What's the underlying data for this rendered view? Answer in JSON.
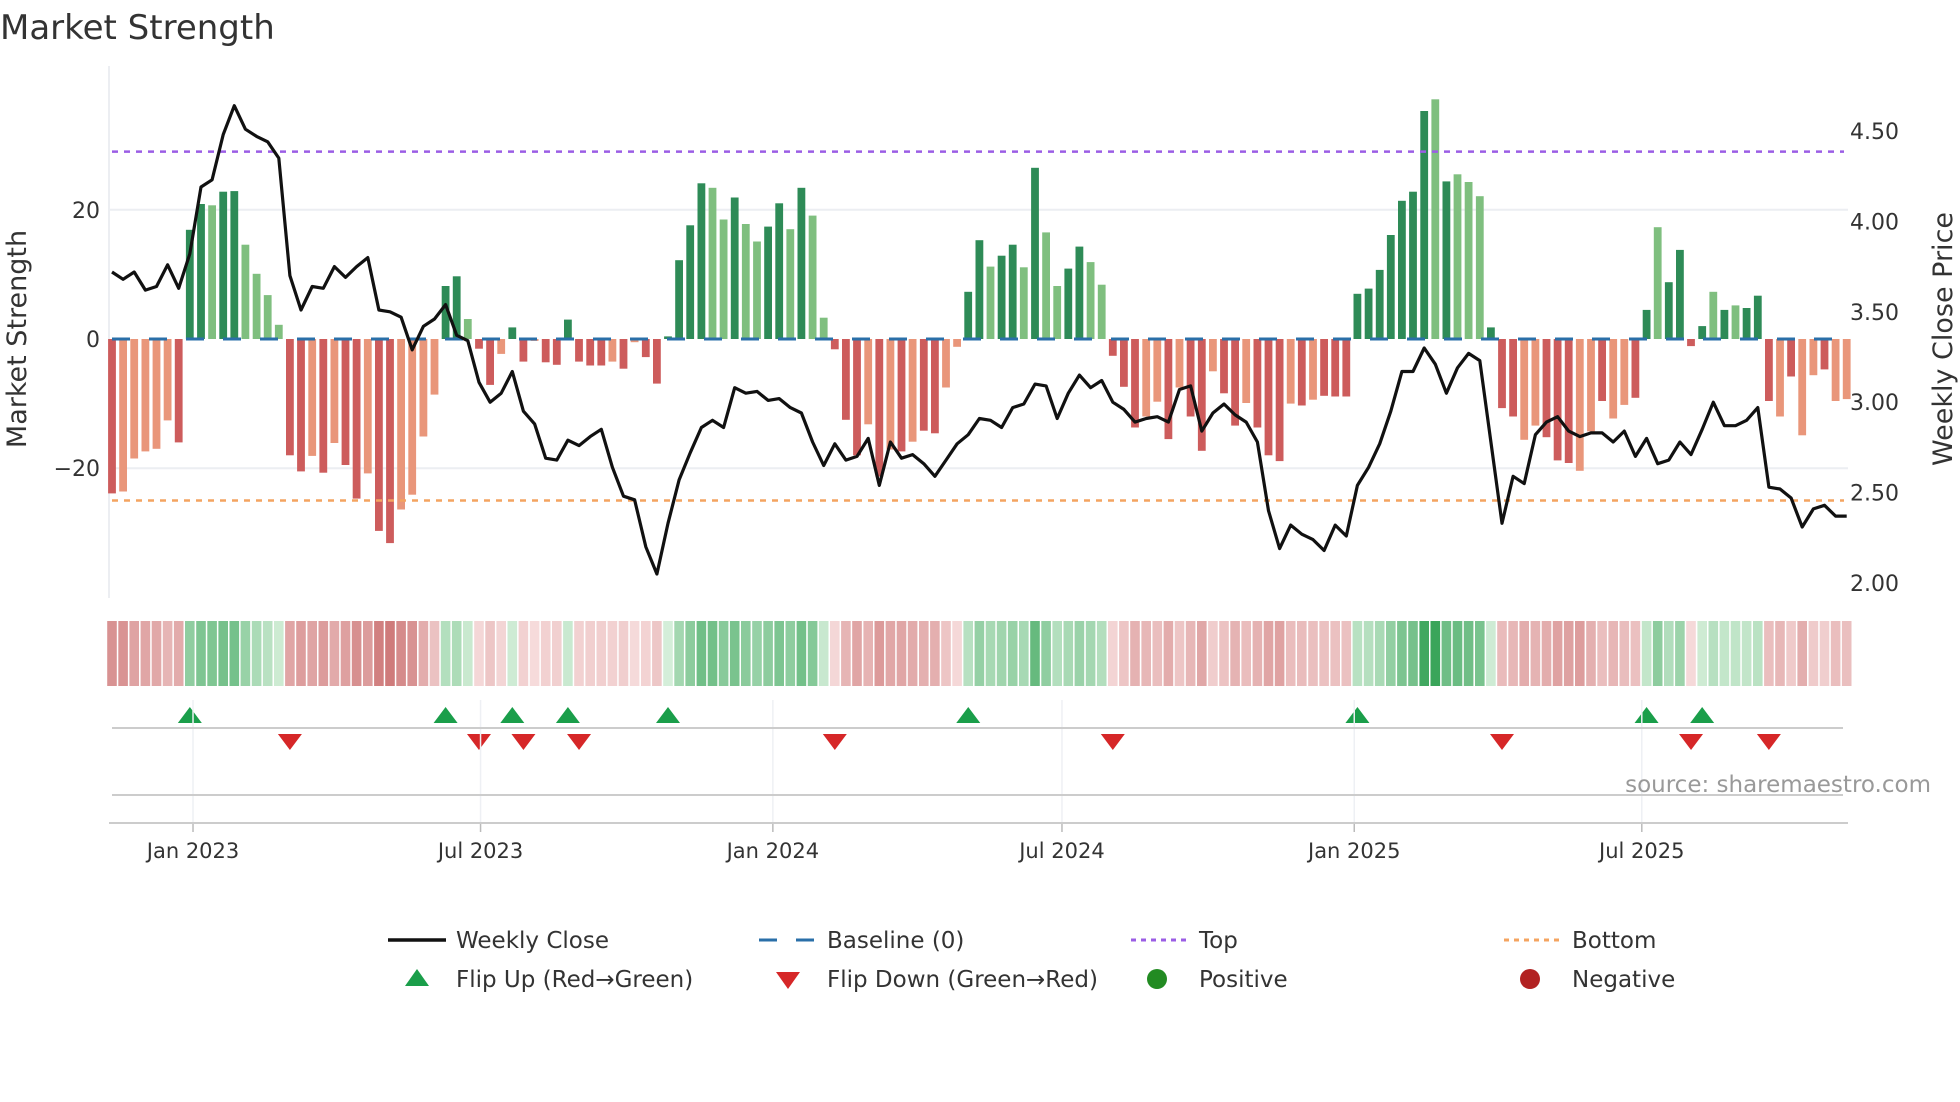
{
  "chart_data": {
    "type": "bar",
    "title": "Market Strength",
    "ylabel": "Market Strength",
    "y2label": "Weekly Close Price",
    "ylim": [
      -40,
      40
    ],
    "y2lim": [
      1.92,
      4.78
    ],
    "start_date": "2022-11-11",
    "frequency": "weekly",
    "yticks": [
      {
        "value": 20,
        "label": "20"
      },
      {
        "value": 0,
        "label": "0"
      },
      {
        "value": -20,
        "label": "−20"
      }
    ],
    "y2ticks": [
      {
        "value": 4.5,
        "label": "4.50"
      },
      {
        "value": 4.0,
        "label": "4.00"
      },
      {
        "value": 3.5,
        "label": "3.50"
      },
      {
        "value": 3.0,
        "label": "3.00"
      },
      {
        "value": 2.5,
        "label": "2.50"
      },
      {
        "value": 2.0,
        "label": "2.00"
      }
    ],
    "xticks": [
      {
        "date": "2023-01-01",
        "label": "Jan 2023"
      },
      {
        "date": "2023-07-01",
        "label": "Jul 2023"
      },
      {
        "date": "2024-01-01",
        "label": "Jan 2024"
      },
      {
        "date": "2024-07-01",
        "label": "Jul 2024"
      },
      {
        "date": "2025-01-01",
        "label": "Jan 2025"
      },
      {
        "date": "2025-07-01",
        "label": "Jul 2025"
      }
    ],
    "top_level": 29,
    "bottom_level": -25,
    "baseline": 0,
    "strength": [
      -23.9,
      -23.6,
      -18.5,
      -17.4,
      -17.0,
      -12.6,
      -16.0,
      16.9,
      20.9,
      20.7,
      22.8,
      22.9,
      14.6,
      10.1,
      6.8,
      2.2,
      -18.0,
      -20.5,
      -18.1,
      -20.7,
      -16.1,
      -19.5,
      -24.7,
      -20.8,
      -29.7,
      -31.6,
      -26.4,
      -24.1,
      -15.1,
      -8.6,
      8.2,
      9.7,
      3.1,
      -1.5,
      -7.1,
      -2.3,
      1.8,
      -3.5,
      -0.3,
      -3.6,
      -4.0,
      3.0,
      -3.5,
      -4.1,
      -4.1,
      -3.5,
      -4.6,
      -0.5,
      -2.8,
      -6.9,
      0.4,
      12.2,
      17.6,
      24.1,
      23.4,
      18.5,
      21.9,
      17.8,
      15.1,
      17.4,
      21.0,
      17.0,
      23.4,
      19.1,
      3.3,
      -1.6,
      -12.5,
      -18.0,
      -13.2,
      -21.3,
      -17.1,
      -17.4,
      -15.9,
      -14.2,
      -14.6,
      -7.5,
      -1.2,
      7.3,
      15.3,
      11.2,
      12.9,
      14.6,
      11.1,
      26.5,
      16.5,
      8.2,
      10.9,
      14.3,
      11.9,
      8.4,
      -2.6,
      -7.4,
      -13.7,
      -12.0,
      -9.7,
      -15.5,
      -7.5,
      -12.0,
      -17.3,
      -5.0,
      -8.4,
      -13.4,
      -9.9,
      -13.7,
      -18.0,
      -18.9,
      -10.0,
      -10.3,
      -9.4,
      -8.8,
      -8.9,
      -8.9,
      7.0,
      7.8,
      10.7,
      16.1,
      21.4,
      22.8,
      35.3,
      37.1,
      24.4,
      25.5,
      24.3,
      22.1,
      1.8,
      -10.7,
      -12.0,
      -15.6,
      -13.4,
      -15.2,
      -18.8,
      -19.2,
      -20.4,
      -14.3,
      -9.6,
      -12.3,
      -10.2,
      -9.1,
      4.5,
      17.3,
      8.8,
      13.8,
      -1.1,
      2.0,
      7.3,
      4.5,
      5.2,
      4.8,
      6.7,
      -9.6,
      -12.0,
      -5.8,
      -14.9,
      -5.6,
      -4.7,
      -9.6,
      -9.3
    ],
    "shade": "DLLLLLDDDLDDLLLLDDLDLDDLDDLLLLDDLDDLDDLDDDDDDLDLDDDDDDLLDLLDDLDLLDDDLDLDLDDLLDDLDDLDLLDDLLDDDLLDLDDLDDLDDDLDLDDDDDDDDDDLDLLLDDDLLDDDLLDLLDDLDDDDLDLDDDLDLLDL",
    "weekly_close": [
      3.72,
      3.68,
      3.72,
      3.62,
      3.64,
      3.76,
      3.63,
      3.82,
      4.19,
      4.23,
      4.48,
      4.64,
      4.51,
      4.47,
      4.44,
      4.35,
      3.7,
      3.51,
      3.64,
      3.63,
      3.75,
      3.69,
      3.75,
      3.8,
      3.51,
      3.5,
      3.47,
      3.29,
      3.42,
      3.46,
      3.54,
      3.37,
      3.34,
      3.11,
      3.0,
      3.05,
      3.17,
      2.95,
      2.88,
      2.69,
      2.68,
      2.79,
      2.76,
      2.81,
      2.85,
      2.64,
      2.48,
      2.46,
      2.2,
      2.05,
      2.33,
      2.57,
      2.72,
      2.86,
      2.9,
      2.86,
      3.08,
      3.05,
      3.06,
      3.01,
      3.02,
      2.97,
      2.94,
      2.78,
      2.65,
      2.77,
      2.68,
      2.7,
      2.8,
      2.54,
      2.78,
      2.69,
      2.71,
      2.66,
      2.59,
      2.68,
      2.77,
      2.82,
      2.91,
      2.9,
      2.86,
      2.97,
      2.99,
      3.1,
      3.09,
      2.91,
      3.05,
      3.15,
      3.08,
      3.12,
      3.0,
      2.96,
      2.89,
      2.91,
      2.92,
      2.89,
      3.07,
      3.09,
      2.84,
      2.94,
      2.99,
      2.93,
      2.89,
      2.78,
      2.4,
      2.19,
      2.32,
      2.27,
      2.24,
      2.18,
      2.32,
      2.26,
      2.54,
      2.64,
      2.77,
      2.95,
      3.17,
      3.17,
      3.3,
      3.21,
      3.05,
      3.19,
      3.27,
      3.23,
      2.78,
      2.33,
      2.59,
      2.55,
      2.82,
      2.89,
      2.92,
      2.84,
      2.81,
      2.83,
      2.83,
      2.78,
      2.84,
      2.7,
      2.8,
      2.66,
      2.68,
      2.78,
      2.71,
      2.85,
      3.0,
      2.87,
      2.87,
      2.9,
      2.97,
      2.53,
      2.52,
      2.47,
      2.31,
      2.41,
      2.43,
      2.37,
      2.37
    ],
    "flip_up_weeks": [
      8,
      31,
      37,
      42,
      51,
      78,
      113,
      139,
      144
    ],
    "flip_down_weeks": [
      17,
      34,
      38,
      43,
      66,
      91,
      126,
      143,
      150
    ],
    "legend": [
      {
        "label": "Weekly Close",
        "kind": "line"
      },
      {
        "label": "Baseline (0)",
        "kind": "dash"
      },
      {
        "label": "Top",
        "kind": "dot-top"
      },
      {
        "label": "Bottom",
        "kind": "dot-bottom"
      },
      {
        "label": "Flip Up (Red→Green)",
        "kind": "tri-up"
      },
      {
        "label": "Flip Down (Green→Red)",
        "kind": "tri-down"
      },
      {
        "label": "Positive",
        "kind": "dot-pos"
      },
      {
        "label": "Negative",
        "kind": "dot-neg"
      }
    ],
    "legend_placement": "bottom",
    "source": "source: sharemaestro.com",
    "colors": {
      "green_strong": "#2e8b57",
      "green_weak": "#7fbf7f",
      "red_strong": "#cd5c5c",
      "red_weak": "#e9967a",
      "price": "#111111",
      "baseline": "#2a6fa8",
      "top": "#9b5de5",
      "bottom": "#f4a460",
      "flip_up": "#1a9e4a",
      "flip_down": "#d62728",
      "positive": "#228b22",
      "negative": "#b22222"
    }
  }
}
